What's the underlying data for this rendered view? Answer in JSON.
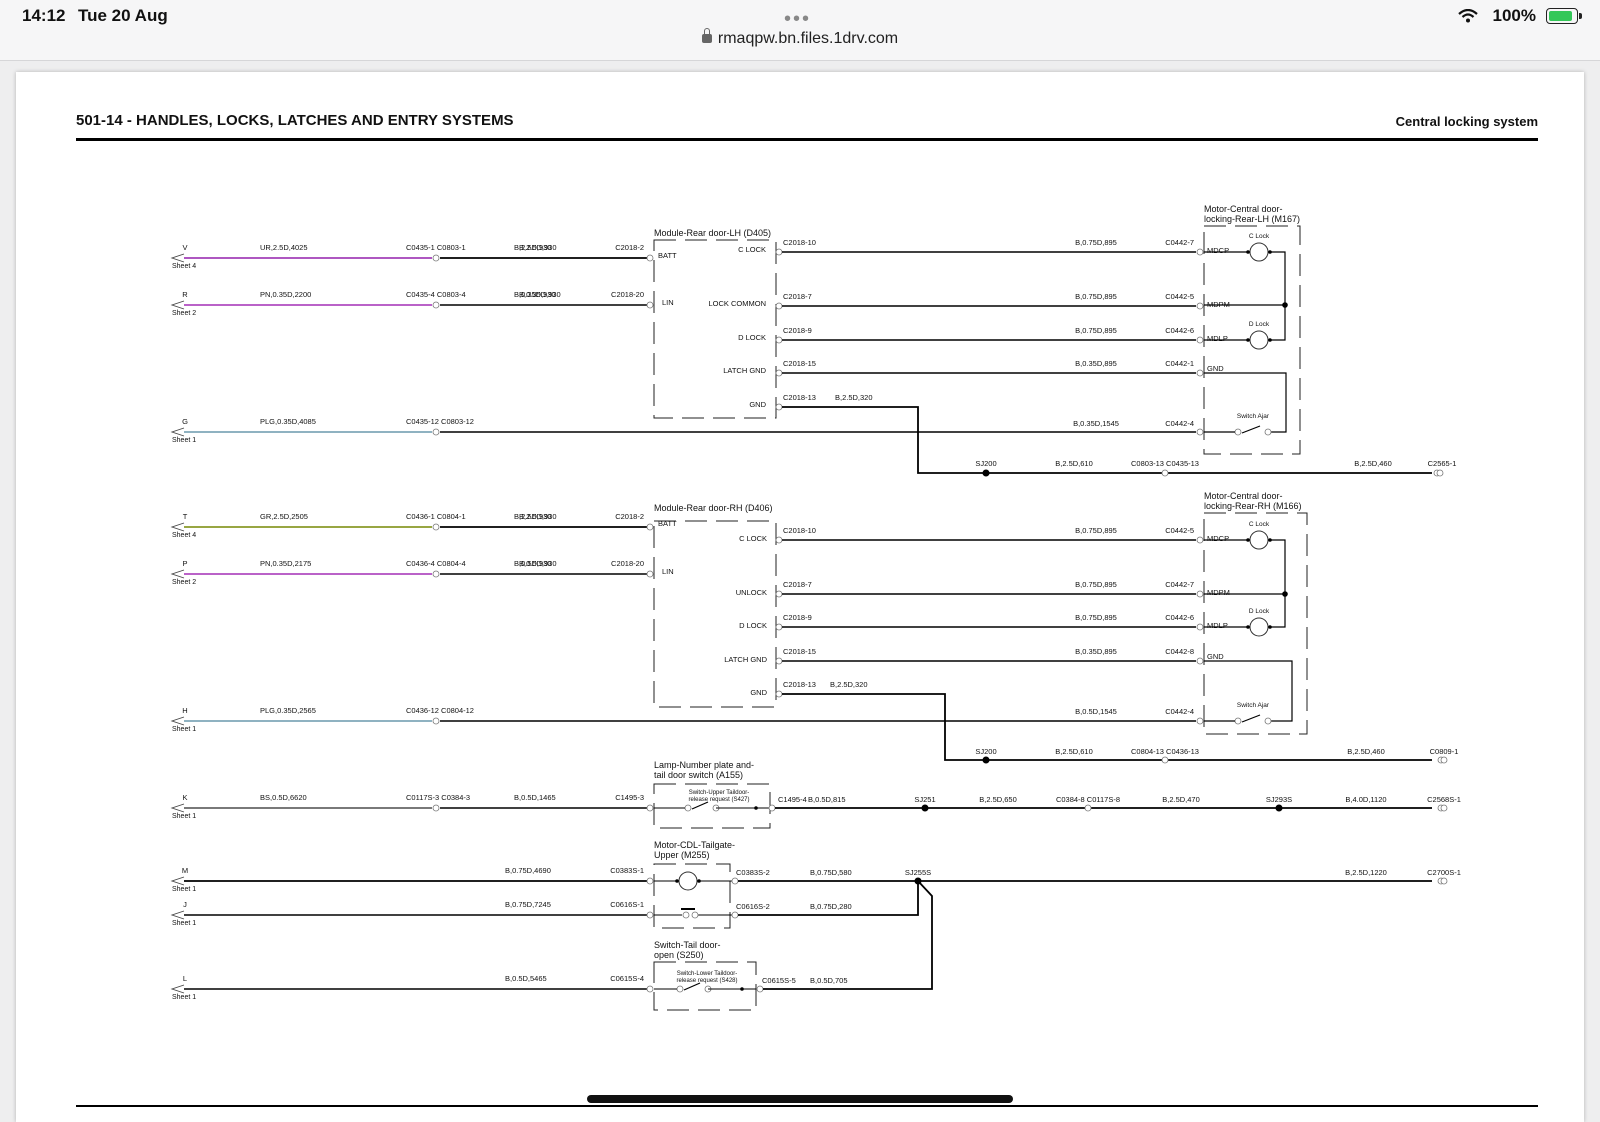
{
  "status_bar": {
    "time": "14:12",
    "date": "Tue 20 Aug",
    "url": "rmaqpw.bn.files.1drv.com",
    "battery": "100%"
  },
  "document": {
    "title": "501-14 - HANDLES, LOCKS, LATCHES AND ENTRY SYSTEMS",
    "subtitle": "Central locking system"
  },
  "boxes": {
    "d405": "Module-Rear door-LH (D405)",
    "m167": [
      "Motor-Central door-",
      "locking-Rear-LH (M167)"
    ],
    "d406": "Module-Rear door-RH (D406)",
    "m166": [
      "Motor-Central door-",
      "locking-Rear-RH (M166)"
    ],
    "a155": [
      "Lamp-Number plate and-",
      "tail door switch (A155)"
    ],
    "s427": [
      "Switch-Upper Taildoor-",
      "release request (S427)"
    ],
    "m255": [
      "Motor-CDL-Tailgate-",
      "Upper (M255)"
    ],
    "s250": [
      "Switch-Tail door-",
      "open (S250)"
    ],
    "s428": [
      "Switch-Lower Taildoor-",
      "release request (S428)"
    ]
  },
  "pins": {
    "d405": [
      "BATT",
      "LIN",
      "C LOCK",
      "LOCK COMMON",
      "D LOCK",
      "LATCH GND",
      "GND"
    ],
    "d406": [
      "BATT",
      "LIN",
      "C LOCK",
      "UNLOCK",
      "D LOCK",
      "LATCH GND",
      "GND"
    ],
    "motor": [
      "MDCP",
      "MDPM",
      "MDLP",
      "GND"
    ],
    "c_lock": "C Lock",
    "d_lock": "D Lock",
    "switch_ajar": "Switch Ajar"
  },
  "inputs": [
    {
      "letter": "V",
      "sheet": "Sheet 4",
      "wire": "UR,2.5D,4025",
      "conn": "C0435-1 C0803-1",
      "wire2": "B,2.5D,930",
      "pin": "C2018-2"
    },
    {
      "letter": "R",
      "sheet": "Sheet 2",
      "wire": "PN,0.35D,2200",
      "conn": "C0435-4 C0803-4",
      "wire2": "B,0.35D,930",
      "pin": "C2018-20"
    },
    {
      "letter": "G",
      "sheet": "Sheet 1",
      "wire": "PLG,0.35D,4085",
      "conn": "C0435-12 C0803-12"
    },
    {
      "letter": "T",
      "sheet": "Sheet 4",
      "wire": "GR,2.5D,2505",
      "conn": "C0436-1 C0804-1",
      "wire2": "B,2.5D,930",
      "pin": "C2018-2"
    },
    {
      "letter": "P",
      "sheet": "Sheet 2",
      "wire": "PN,0.35D,2175",
      "conn": "C0436-4 C0804-4",
      "wire2": "B,0.5D,930",
      "pin": "C2018-20"
    },
    {
      "letter": "H",
      "sheet": "Sheet 1",
      "wire": "PLG,0.35D,2565",
      "conn": "C0436-12 C0804-12"
    },
    {
      "letter": "K",
      "sheet": "Sheet 1",
      "wire": "BS,0.5D,6620",
      "conn": "C0117S-3 C0384-3",
      "wire2": "B,0.5D,1465",
      "pin": "C1495-3"
    },
    {
      "letter": "M",
      "sheet": "Sheet 1",
      "wire2": "B,0.75D,4690",
      "pin": "C0383S-1"
    },
    {
      "letter": "J",
      "sheet": "Sheet 1",
      "wire2": "B,0.75D,7245",
      "pin": "C0616S-1"
    },
    {
      "letter": "L",
      "sheet": "Sheet 1",
      "wire2": "B,0.5D,5465",
      "pin": "C0615S-4"
    }
  ],
  "lh_wires": [
    {
      "pin": "C2018-10",
      "wire": "B,0.75D,895",
      "conn": "C0442-7"
    },
    {
      "pin": "C2018-7",
      "wire": "B,0.75D,895",
      "conn": "C0442-5"
    },
    {
      "pin": "C2018-9",
      "wire": "B,0.75D,895",
      "conn": "C0442-6"
    },
    {
      "pin": "C2018-15",
      "wire": "B,0.35D,895",
      "conn": "C0442-1"
    },
    {
      "pin": "C2018-13",
      "wire": "B,2.5D,320"
    }
  ],
  "lh_g_line": {
    "wire": "B,0.35D,1545",
    "conn": "C0442-4"
  },
  "lh_ground": {
    "splice": "SJ200",
    "wire": "B,2.5D,610",
    "conn": "C0803-13 C0435-13",
    "wire2": "B,2.5D,460",
    "end": "C2565-1"
  },
  "rh_wires": [
    {
      "pin": "C2018-10",
      "wire": "B,0.75D,895",
      "conn": "C0442-5"
    },
    {
      "pin": "C2018-7",
      "wire": "B,0.75D,895",
      "conn": "C0442-7"
    },
    {
      "pin": "C2018-9",
      "wire": "B,0.75D,895",
      "conn": "C0442-6"
    },
    {
      "pin": "C2018-15",
      "wire": "B,0.35D,895",
      "conn": "C0442-8"
    },
    {
      "pin": "C2018-13",
      "wire": "B,2.5D,320"
    }
  ],
  "rh_h_line": {
    "wire": "B,0.5D,1545",
    "conn": "C0442-4"
  },
  "rh_ground": {
    "splice": "SJ200",
    "wire": "B,2.5D,610",
    "conn": "C0804-13 C0436-13",
    "wire2": "B,2.5D,460",
    "end": "C0809-1"
  },
  "k_line": {
    "pin": "C1495-4",
    "wire": "B,0.5D,815",
    "splice1": "SJ251",
    "wire2": "B,2.5D,650",
    "conn": "C0384-8 C0117S-8",
    "wire3": "B,2.5D,470",
    "splice2": "SJ293S",
    "wire4": "B,4.0D,1120",
    "end": "C2568S-1"
  },
  "m_line": {
    "pin": "C0383S-2",
    "wire": "B,0.75D,580",
    "splice": "SJ255S",
    "wire2": "B,2.5D,1220",
    "end": "C2700S-1"
  },
  "j_line": {
    "pin": "C0616S-2",
    "wire": "B,0.75D,280"
  },
  "l_line": {
    "pin": "C0615S-5",
    "wire": "B,0.5D,705"
  },
  "colors": {
    "violet": "#a23fb8",
    "pink": "#b04cc0",
    "plg": "#7fa7b8",
    "gr": "#8a9a28",
    "bs": "#666666"
  }
}
